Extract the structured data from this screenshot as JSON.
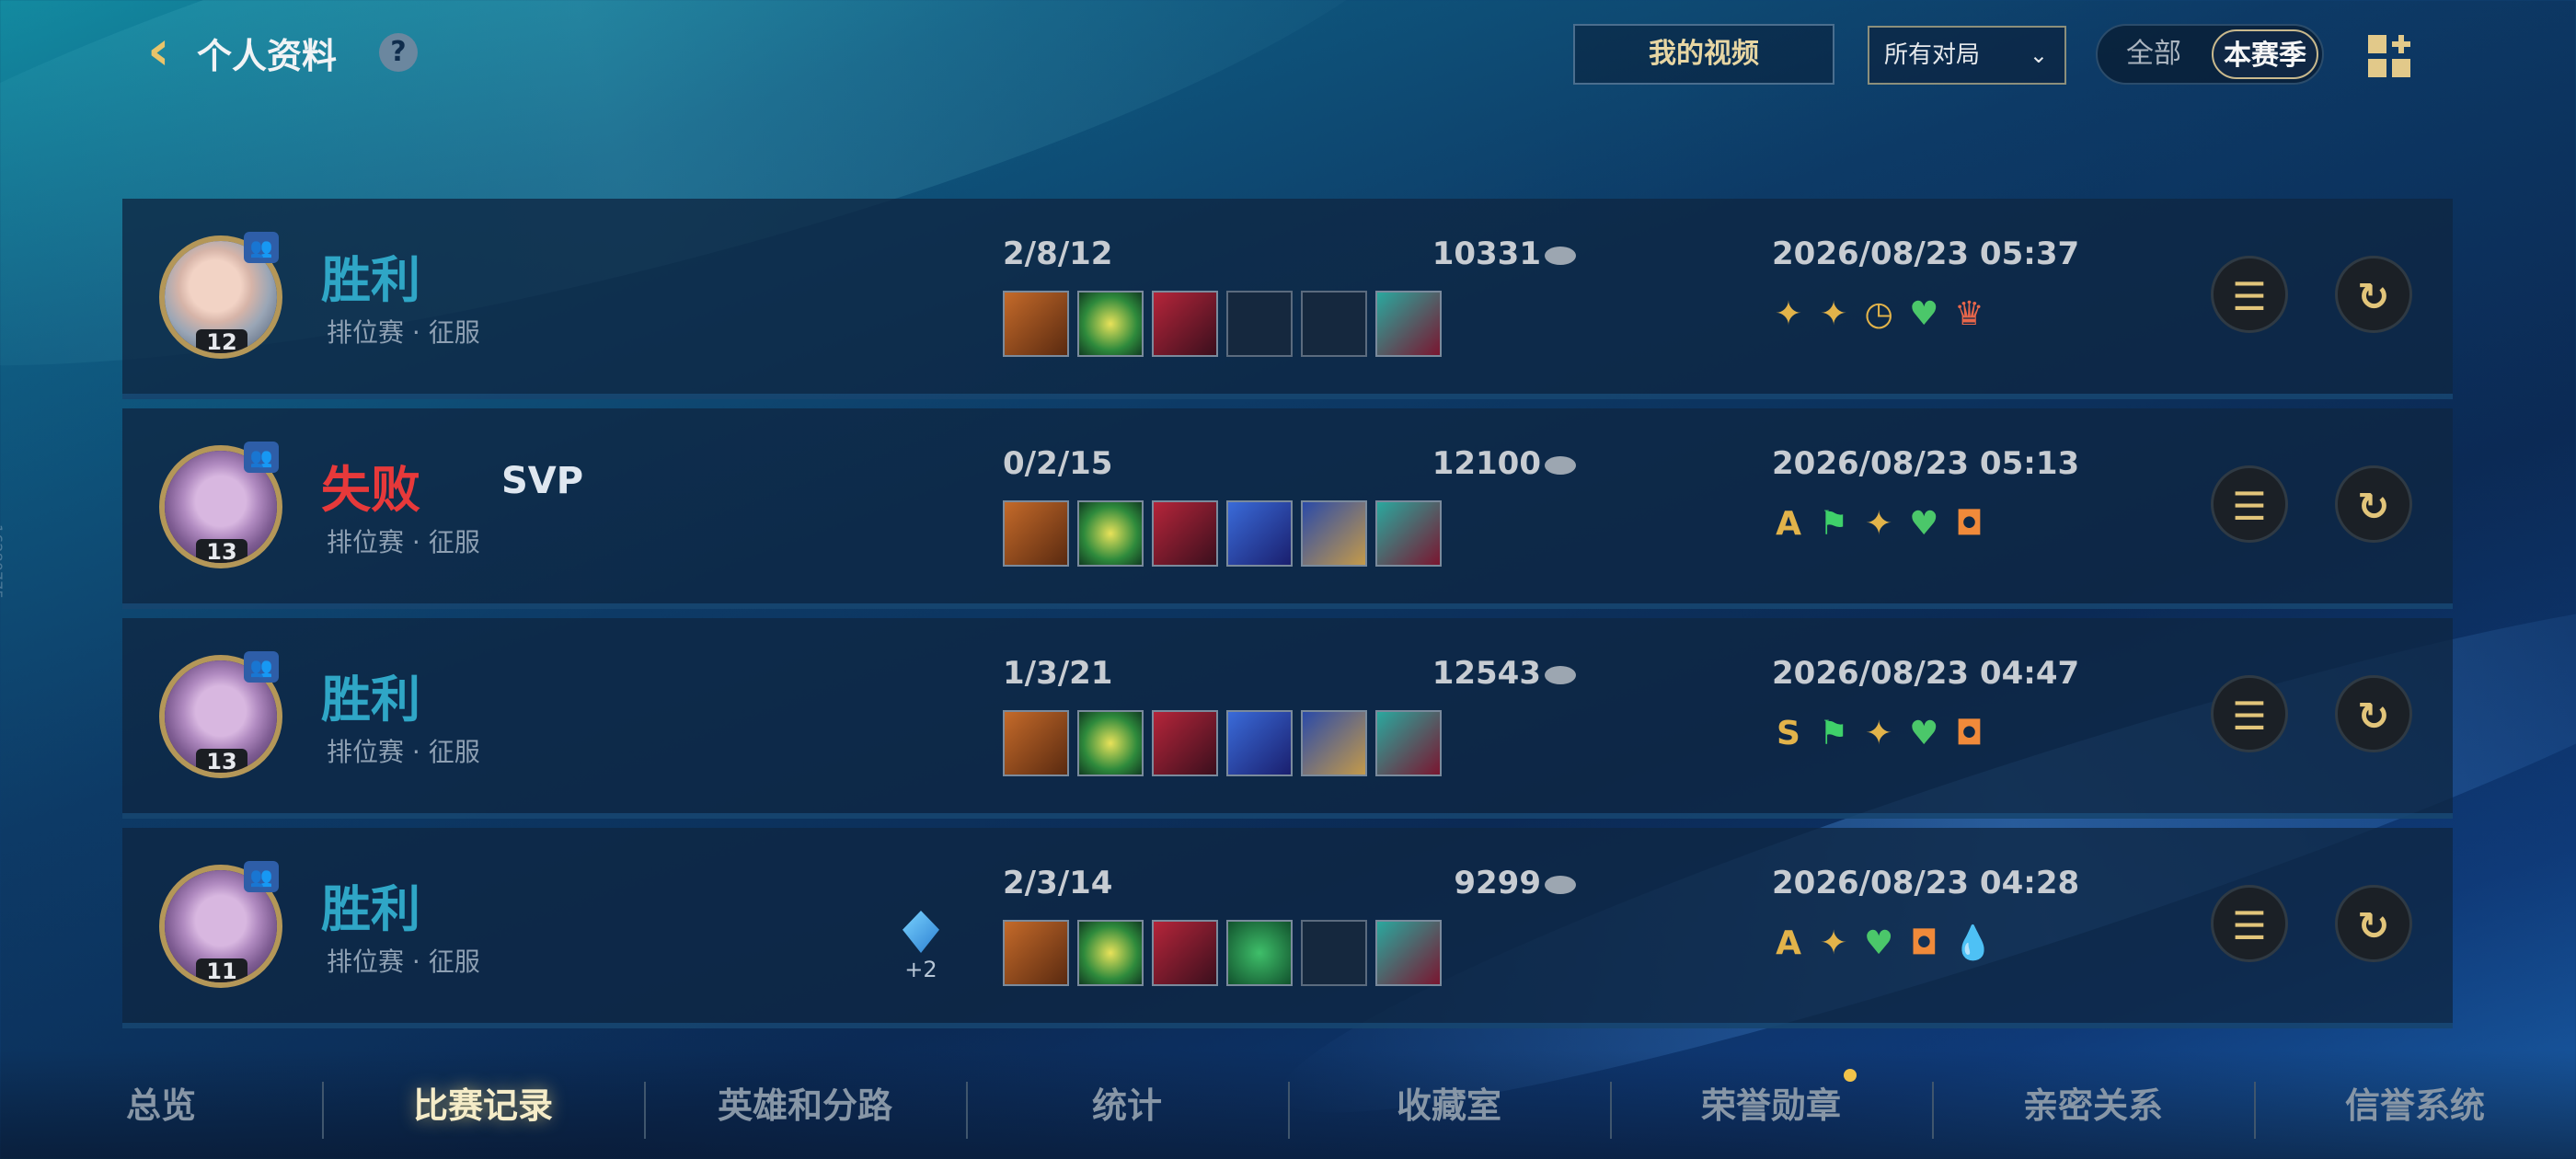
{
  "header": {
    "title": "个人资料",
    "help_icon": "?",
    "video_button": "我的视频",
    "filter_select": "所有对局",
    "segment_all": "全部",
    "segment_season": "本赛季"
  },
  "matches": [
    {
      "result": "胜利",
      "level": "12",
      "mode": "排位赛 · 征服",
      "kda": "2/8/12",
      "gold": "10331",
      "date": "2026/08/23 05:37",
      "tags": []
    },
    {
      "result": "失败",
      "svp": "SVP",
      "level": "13",
      "mode": "排位赛 · 征服",
      "kda": "0/2/15",
      "gold": "12100",
      "date": "2026/08/23 05:13",
      "tags": [
        "A"
      ]
    },
    {
      "result": "胜利",
      "level": "13",
      "mode": "排位赛 · 征服",
      "kda": "1/3/21",
      "gold": "12543",
      "date": "2026/08/23 04:47",
      "tags": [
        "S"
      ]
    },
    {
      "result": "胜利",
      "level": "11",
      "mode": "排位赛 · 征服",
      "kda": "2/3/14",
      "gold": "9299",
      "date": "2026/08/23 04:28",
      "gem_plus": "+2",
      "tags": [
        "A"
      ]
    }
  ],
  "bottom_nav": [
    "总览",
    "比赛记录",
    "英雄和分路",
    "统计",
    "收藏室",
    "荣誉勋章",
    "亲密关系",
    "信誉系统"
  ],
  "side_id": "16280775",
  "colors": {
    "win": "#2fa6c6",
    "lose": "#e7393a",
    "accent_gold": "#e2c57a"
  }
}
